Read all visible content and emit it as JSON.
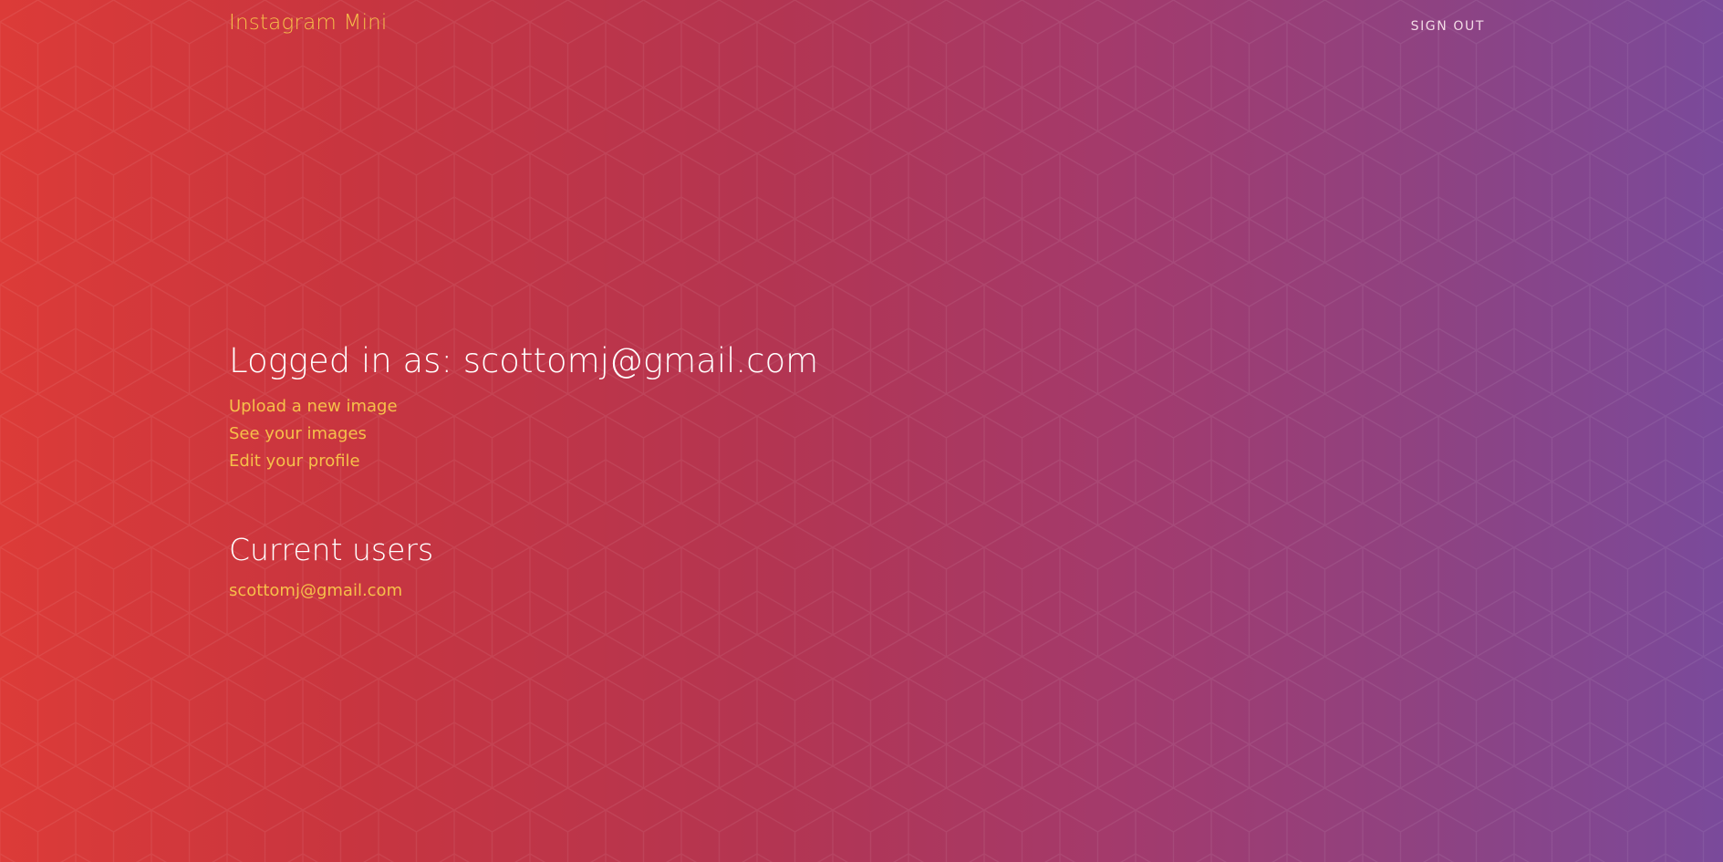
{
  "colors": {
    "accent": "#f6c04a",
    "heading": "#ffffff",
    "nav_link": "#f3dbe6",
    "gradient_start": "#dc3b38",
    "gradient_end": "#7a4a9b"
  },
  "header": {
    "brand": "Instagram Mini",
    "sign_out": "SIGN OUT"
  },
  "main": {
    "logged_in_heading": "Logged in as: scottomj@gmail.com",
    "links": [
      {
        "label": "Upload a new image"
      },
      {
        "label": "See your images"
      },
      {
        "label": "Edit your profile"
      }
    ],
    "users_heading": "Current users",
    "users": [
      {
        "email": "scottomj@gmail.com"
      }
    ]
  }
}
